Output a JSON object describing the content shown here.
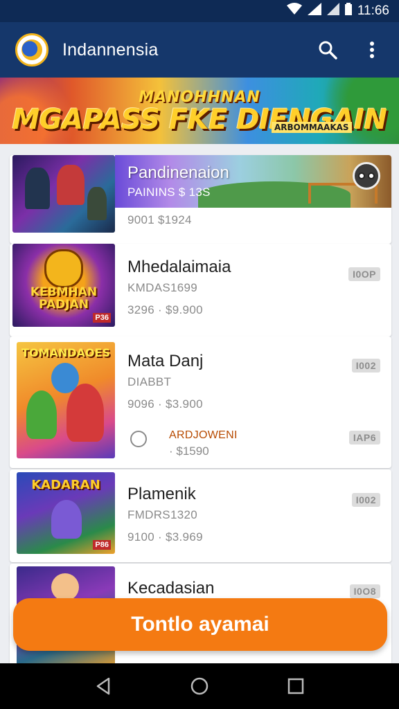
{
  "status_bar": {
    "time": "11:66",
    "icons": [
      "wifi-icon",
      "signal-icon",
      "signal-icon",
      "battery-icon"
    ]
  },
  "app_bar": {
    "title": "Indannensia",
    "logo_icon": "app-logo-icon",
    "actions": [
      "search-icon",
      "more-vert-icon"
    ]
  },
  "banner": {
    "line1": "MANOHHNAN",
    "line2": "MGAPASS FKE DIENGAIN",
    "sub": "ARBOMMAAKAS"
  },
  "items": [
    {
      "title": "Pandinenaion",
      "subtitle": "PAININS $ 13S",
      "price": "9001  $1924",
      "badge": "",
      "thumb_text": ""
    },
    {
      "title": "Mhedalaimaia",
      "subtitle": "KMDAS1699",
      "price": "3296 · $9.900",
      "badge": "I0OP",
      "thumb_text": "KEBMHAN PADJAN",
      "thumb_corner": "P36"
    },
    {
      "title": "Mata Danj",
      "subtitle": "DIABBT",
      "price": "9096 · $3.900",
      "badge": "I002",
      "thumb_text": "TOMANDAOES",
      "order_label": "ARDJOWENI",
      "order_price": "· $1590",
      "order_badge": "IAP6"
    },
    {
      "title": "Plamenik",
      "subtitle": "FMDRS1320",
      "price": "9100 · $3.969",
      "badge": "I002",
      "thumb_text": "KADARAN",
      "thumb_corner": "P86"
    },
    {
      "title": "Kecadasian",
      "subtitle": "",
      "price": "",
      "badge": "I0O8",
      "thumb_text": ""
    }
  ],
  "cta": {
    "label": "Tontlo ayamai"
  },
  "nav_bar": {
    "buttons": [
      "back-icon",
      "home-icon",
      "recents-icon"
    ]
  },
  "colors": {
    "status_bar": "#0e2a55",
    "app_bar": "#15376b",
    "accent": "#f47a12",
    "badge_bg": "#dcdcdc"
  }
}
